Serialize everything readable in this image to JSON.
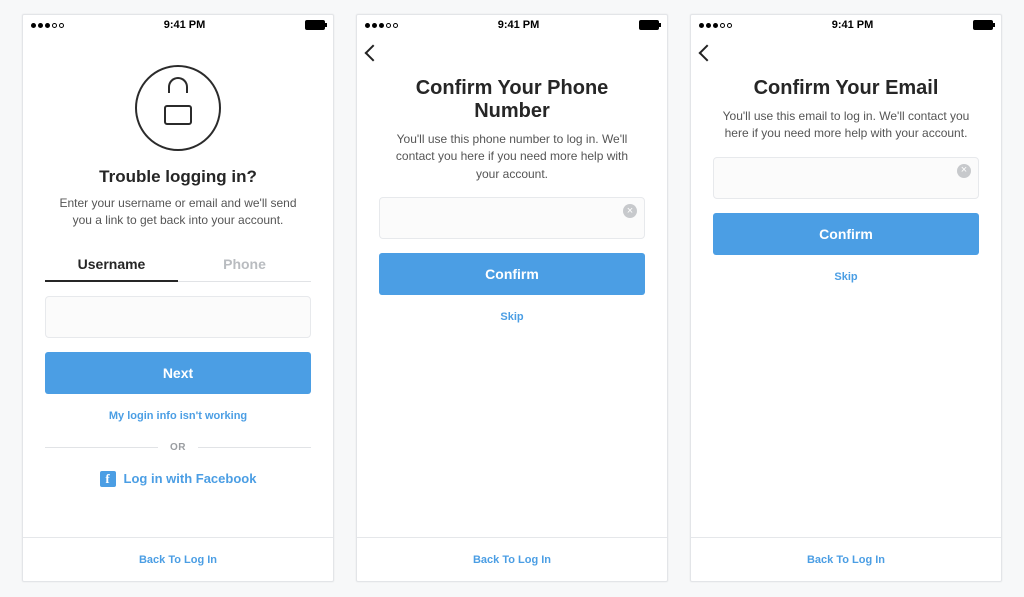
{
  "status": {
    "time": "9:41 PM"
  },
  "screen1": {
    "heading": "Trouble logging in?",
    "subtext": "Enter your username or email and we'll send you a link to get back into your account.",
    "tab_username": "Username",
    "tab_phone": "Phone",
    "next_label": "Next",
    "help_link": "My login info isn't working",
    "or_label": "OR",
    "facebook_label": "Log in with Facebook",
    "footer_link": "Back To Log In"
  },
  "screen2": {
    "heading": "Confirm Your Phone Number",
    "subtext": "You'll use this phone number to log in. We'll contact you here if you need more help with your account.",
    "confirm_label": "Confirm",
    "skip_label": "Skip",
    "footer_link": "Back To Log In"
  },
  "screen3": {
    "heading": "Confirm Your Email",
    "subtext": "You'll use this email to log in. We'll contact you here if you need more help with your account.",
    "confirm_label": "Confirm",
    "skip_label": "Skip",
    "footer_link": "Back To Log In"
  }
}
